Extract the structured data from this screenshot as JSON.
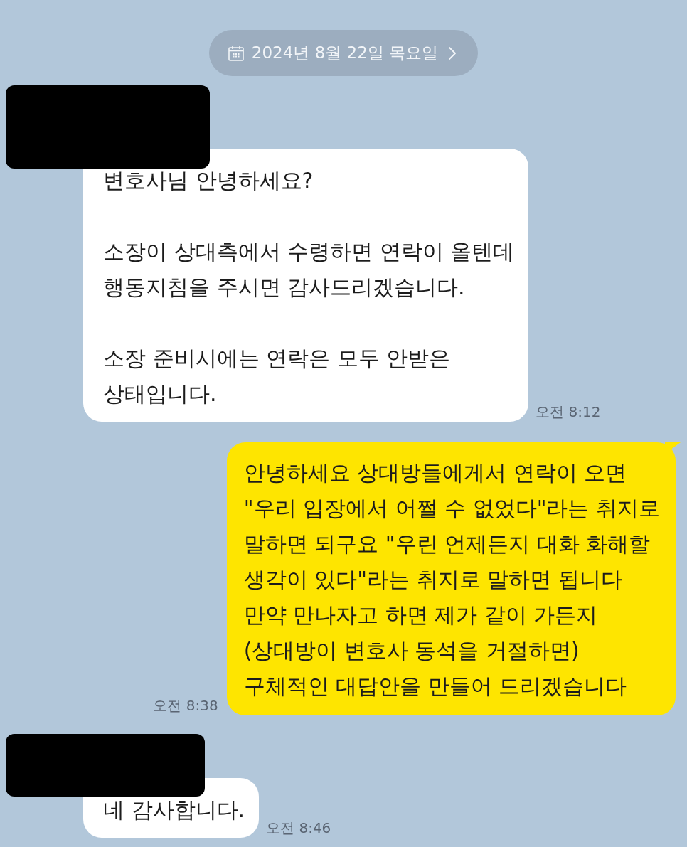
{
  "date_divider": {
    "label": "2024년 8월 22일 목요일"
  },
  "messages": [
    {
      "kind": "incoming",
      "sender_redacted": true,
      "text": "변호사님 안녕하세요?\n\n소장이 상대측에서 수령하면 연락이 올텐데\n행동지침을 주시면 감사드리겠습니다.\n\n소장 준비시에는 연락은 모두 안받은\n상태입니다.",
      "time": "오전 8:12"
    },
    {
      "kind": "outgoing",
      "text": "안녕하세요 상대방들에게서 연락이 오면\n\"우리 입장에서 어쩔 수 없었다\"라는 취지로\n말하면 되구요 \"우린 언제든지 대화 화해할\n생각이 있다\"라는 취지로 말하면 됩니다\n만약 만나자고 하면 제가 같이 가든지\n(상대방이 변호사 동석을 거절하면)\n구체적인 대답안을 만들어 드리겠습니다",
      "time": "오전 8:38"
    },
    {
      "kind": "incoming",
      "sender_redacted": true,
      "text": "네 감사합니다.",
      "time": "오전 8:46"
    }
  ]
}
